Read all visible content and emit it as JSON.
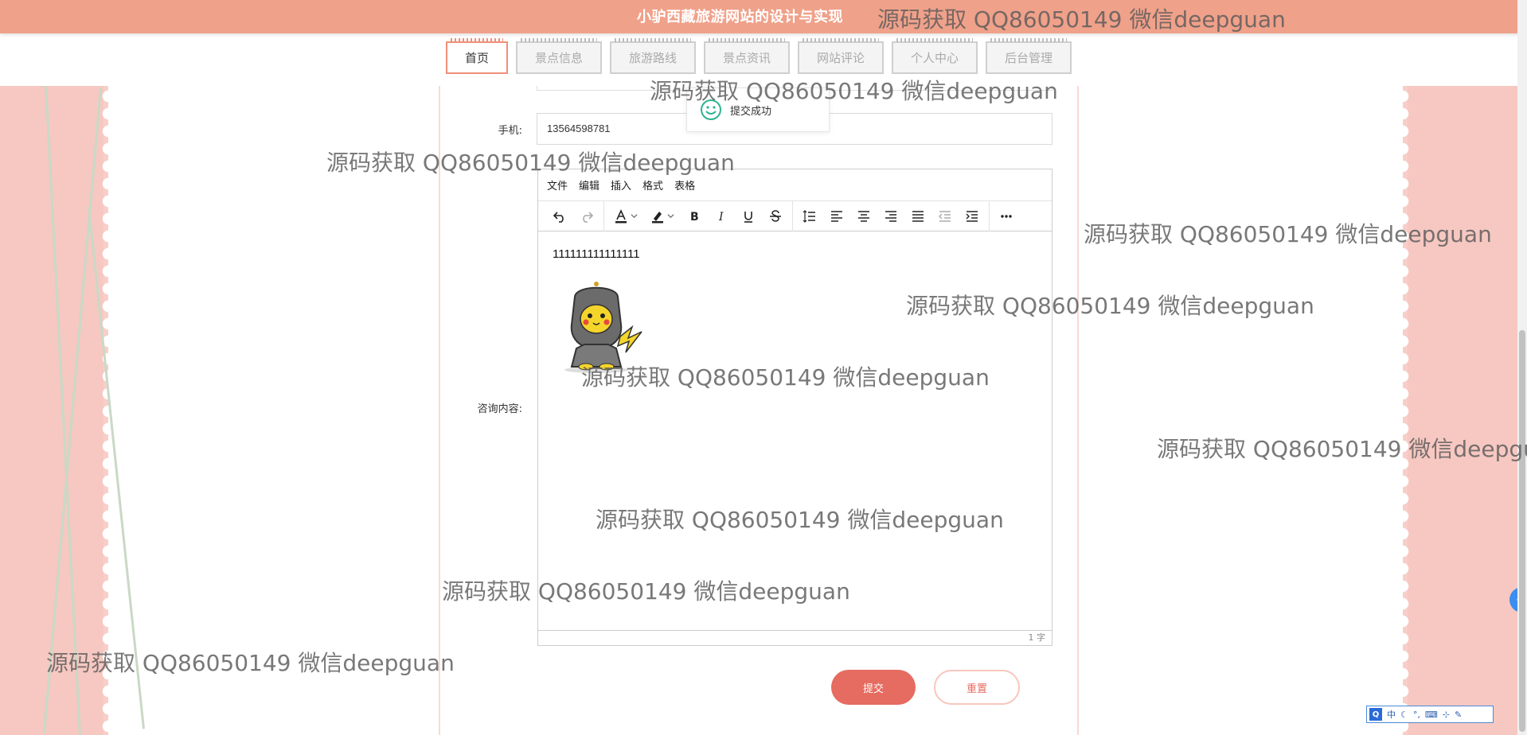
{
  "header": {
    "site_title": "小驴西藏旅游网站的设计与实现",
    "nav": [
      {
        "label": "首页"
      },
      {
        "label": "景点信息"
      },
      {
        "label": "旅游路线"
      },
      {
        "label": "景点资讯"
      },
      {
        "label": "网站评论"
      },
      {
        "label": "个人中心"
      },
      {
        "label": "后台管理"
      }
    ]
  },
  "toast": {
    "message": "提交成功"
  },
  "form": {
    "phone_label": "手机:",
    "phone_value": "13564598781",
    "content_label": "咨询内容:",
    "editor": {
      "menus": [
        "文件",
        "编辑",
        "插入",
        "格式",
        "表格"
      ],
      "body_text": "111111111111111",
      "word_count": "1 字"
    },
    "submit_label": "提交",
    "reset_label": "重置"
  },
  "ime": {
    "logo": "Q",
    "mode": "中"
  },
  "watermark": "源码获取 QQ86050149 微信deepguan",
  "colors": {
    "header_bg": "#f0a18a",
    "accent": "#e66b60",
    "nav_active_border": "#ef8f78"
  }
}
